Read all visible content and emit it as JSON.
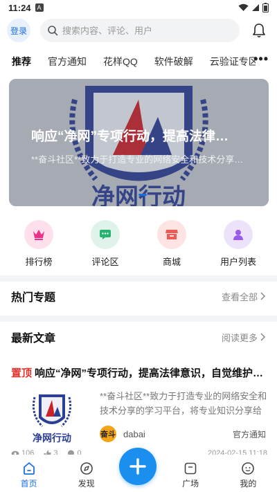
{
  "status_bar": {
    "time": "11:24",
    "notif_letter": "A"
  },
  "header": {
    "login_label": "登录",
    "search_placeholder": "搜索内容、评论、用户"
  },
  "tabs": [
    {
      "label": "推荐",
      "active": true
    },
    {
      "label": "官方通知"
    },
    {
      "label": "花样QQ"
    },
    {
      "label": "软件破解"
    },
    {
      "label": "云验证专区"
    }
  ],
  "banner": {
    "title": "响应“净网”专项行动，提高法律意识，自觉维护网络安全",
    "description": "**奋斗社区**致力于打造专业的网络安全和技术分享的学习平台",
    "emblem_text": "净网行动"
  },
  "shortcuts": [
    {
      "label": "排行榜",
      "icon": "crown-icon",
      "bg": "#fde0ec",
      "fg": "#e8338a"
    },
    {
      "label": "评论区",
      "icon": "comment-icon",
      "bg": "#dff3ea",
      "fg": "#25b36e"
    },
    {
      "label": "商城",
      "icon": "store-icon",
      "bg": "#fde3e2",
      "fg": "#ec5a55"
    },
    {
      "label": "用户列表",
      "icon": "user-icon",
      "bg": "#ece3fb",
      "fg": "#9b5ce8"
    }
  ],
  "hot_topics": {
    "title": "热门专题",
    "link": "查看全部"
  },
  "latest": {
    "title": "最新文章",
    "link": "阅读更多"
  },
  "article": {
    "pin_label": "置顶",
    "title": "响应“净网”专项行动，提高法律意识，自觉维护网络安全",
    "description": "**奋斗社区**致力于打造专业的网络安全和技术分享的学习平台，将专业知识分享给大家",
    "thumb_text": "净网行动",
    "author_avatar_text": "奋斗",
    "author": "dabai",
    "category": "官方通知",
    "views": "106",
    "likes": "3",
    "comments": "0",
    "date": "2024-02-15 11:18"
  },
  "bottom_nav": [
    {
      "label": "首页",
      "icon": "home-icon",
      "active": true
    },
    {
      "label": "发现",
      "icon": "discover-icon"
    },
    {
      "label": "广场",
      "icon": "square-icon"
    },
    {
      "label": "我的",
      "icon": "profile-icon"
    }
  ],
  "colors": {
    "accent": "#1a6fe0",
    "fab": "#1a8ff0",
    "pin": "#e0342e"
  }
}
